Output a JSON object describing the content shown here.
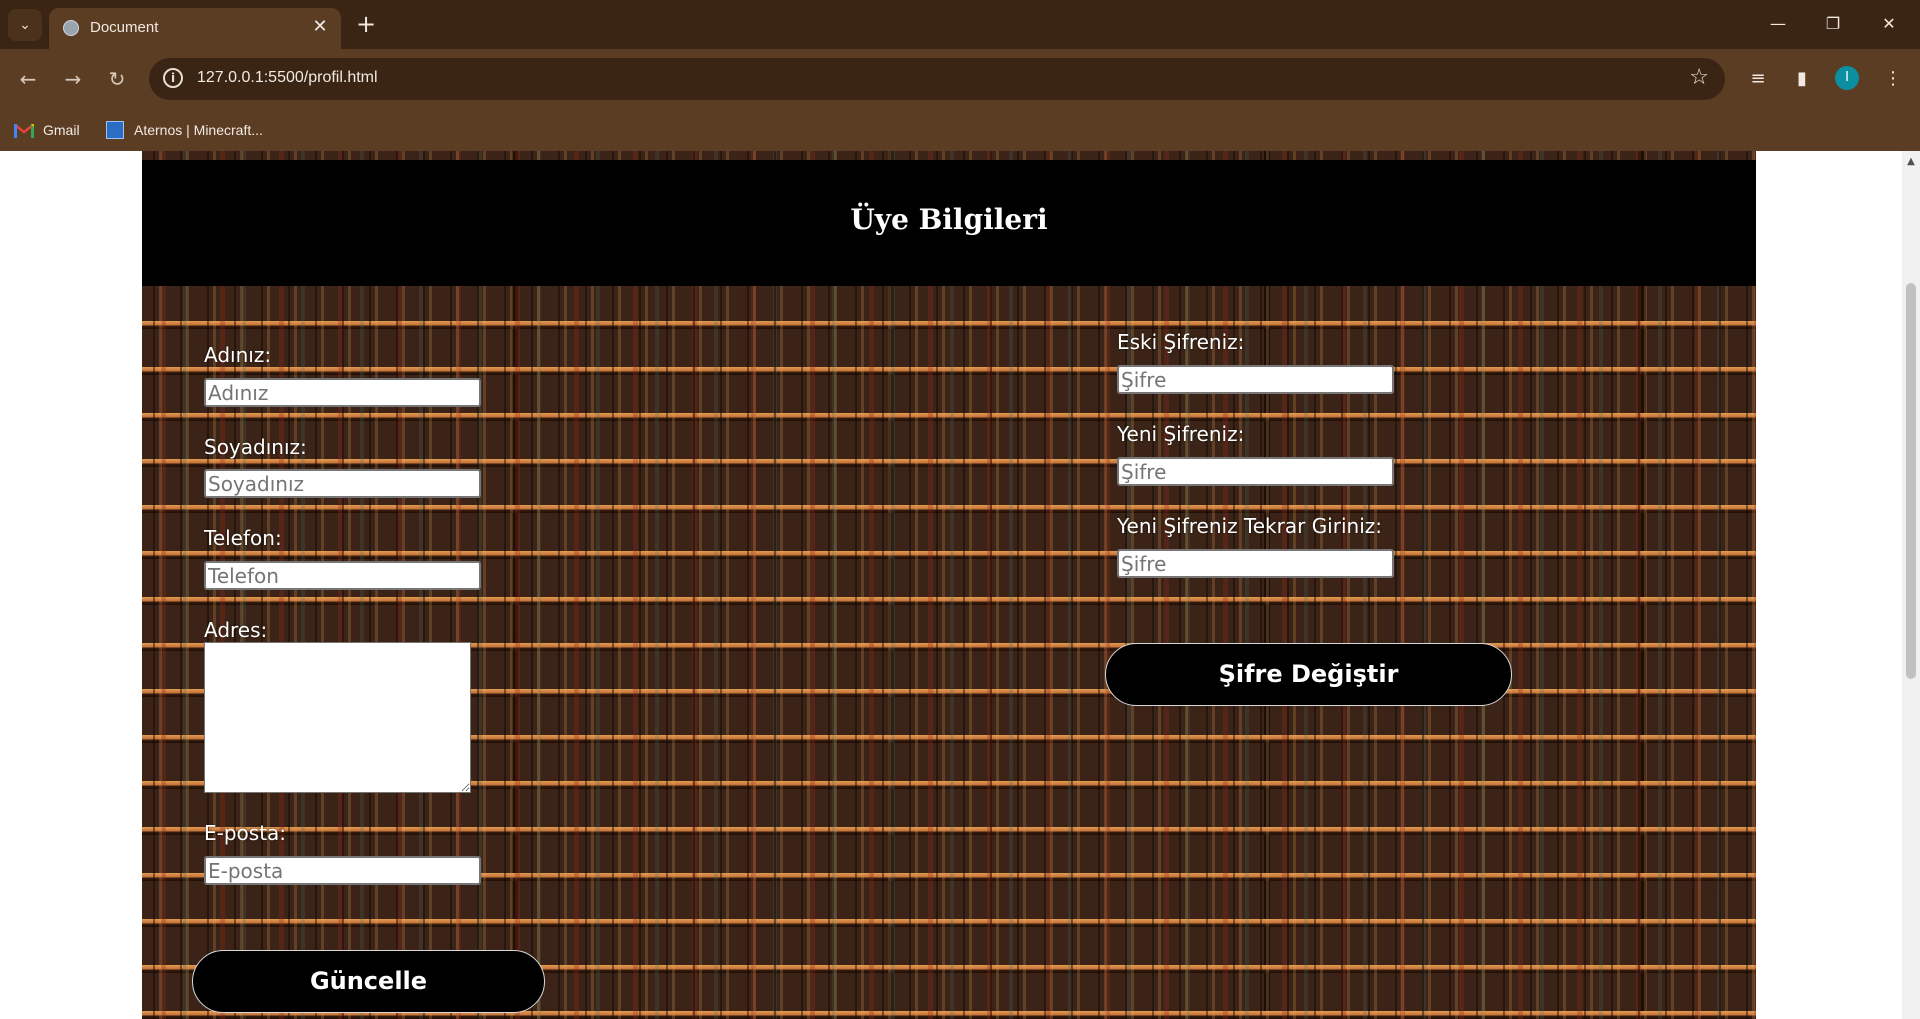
{
  "browser": {
    "tab_title": "Document",
    "url": "127.0.0.1:5500/profil.html",
    "avatar_letter": "I",
    "bookmarks": [
      {
        "label": "Gmail"
      },
      {
        "label": "Aternos | Minecraft..."
      }
    ]
  },
  "page": {
    "title": "Üye Bilgileri",
    "profile_form": {
      "name_label": "Adınız:",
      "name_placeholder": "Adınız",
      "surname_label": "Soyadınız:",
      "surname_placeholder": "Soyadınız",
      "phone_label": "Telefon:",
      "phone_placeholder": "Telefon",
      "address_label": "Adres:",
      "email_label": "E-posta:",
      "email_placeholder": "E-posta",
      "update_button": "Güncelle"
    },
    "password_form": {
      "old_label": "Eski Şifreniz:",
      "old_placeholder": "Şifre",
      "new_label": "Yeni Şifreniz:",
      "new_placeholder": "Şifre",
      "repeat_label": "Yeni Şifreniz Tekrar Giriniz:",
      "repeat_placeholder": "Şifre",
      "change_button": "Şifre Değiştir"
    }
  },
  "colors": {
    "chrome_dark": "#3a2514",
    "chrome_light": "#5b3d24",
    "header_bg": "#000000",
    "button_bg": "#000000",
    "avatar": "#0b8fa1"
  },
  "icons": [
    "tab-search-icon",
    "globe-favicon-icon",
    "close-icon",
    "plus-icon",
    "minimize-icon",
    "restore-icon",
    "window-close-icon",
    "back-arrow-icon",
    "forward-arrow-icon",
    "reload-icon",
    "info-icon",
    "star-icon",
    "media-control-icon",
    "side-panel-icon",
    "more-menu-icon",
    "gmail-icon",
    "aternos-icon"
  ]
}
